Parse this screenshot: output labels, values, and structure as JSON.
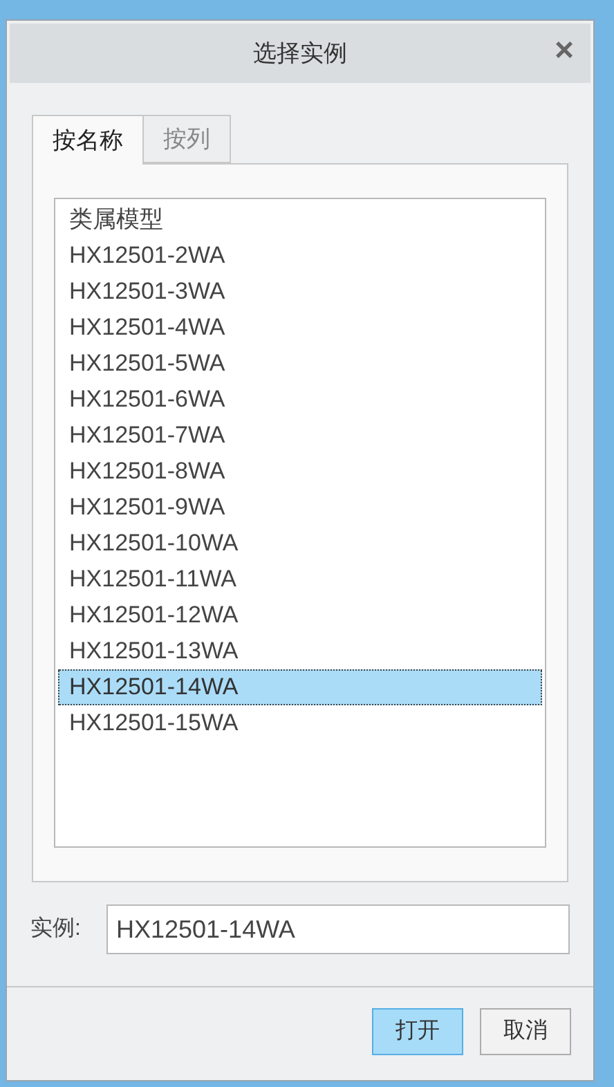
{
  "window": {
    "title": "选择实例",
    "close": "×"
  },
  "tabs": [
    {
      "label": "按名称",
      "selected": true
    },
    {
      "label": "按列",
      "selected": false
    }
  ],
  "list": {
    "items": [
      {
        "label": "类属模型",
        "selected": false
      },
      {
        "label": "HX12501-2WA",
        "selected": false
      },
      {
        "label": "HX12501-3WA",
        "selected": false
      },
      {
        "label": "HX12501-4WA",
        "selected": false
      },
      {
        "label": "HX12501-5WA",
        "selected": false
      },
      {
        "label": "HX12501-6WA",
        "selected": false
      },
      {
        "label": "HX12501-7WA",
        "selected": false
      },
      {
        "label": "HX12501-8WA",
        "selected": false
      },
      {
        "label": "HX12501-9WA",
        "selected": false
      },
      {
        "label": "HX12501-10WA",
        "selected": false
      },
      {
        "label": "HX12501-11WA",
        "selected": false
      },
      {
        "label": "HX12501-12WA",
        "selected": false
      },
      {
        "label": "HX12501-13WA",
        "selected": false
      },
      {
        "label": "HX12501-14WA",
        "selected": true
      },
      {
        "label": "HX12501-15WA",
        "selected": false
      }
    ]
  },
  "instance_field": {
    "label": "实例:",
    "value": "HX12501-14WA"
  },
  "buttons": [
    {
      "label": "打开",
      "default": true
    },
    {
      "label": "取消",
      "default": false
    }
  ]
}
